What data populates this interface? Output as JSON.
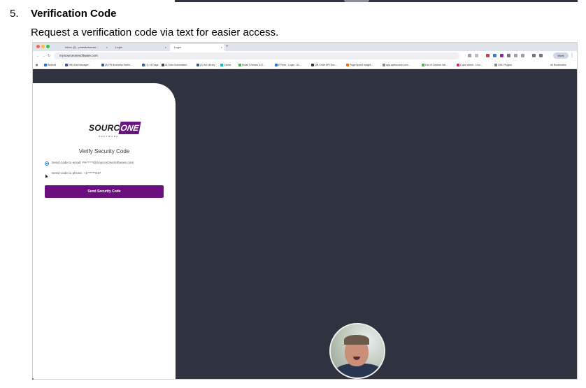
{
  "step": {
    "number": "5.",
    "title": "Verification Code",
    "description": "Request a verification code via text for easier access."
  },
  "browser": {
    "tabs": [
      {
        "label": "Inbox (2) - pmedicisoruer...",
        "active": false
      },
      {
        "label": "Login",
        "active": false
      },
      {
        "label": "Login",
        "active": true
      }
    ],
    "new_tab": "+",
    "url": "my.sourceonesoftware.com",
    "profile": "Work",
    "bookmarks": [
      {
        "label": "Besedd",
        "color": "#1a73e8"
      },
      {
        "label": "(96) Ads Manager...",
        "color": "#3b5998"
      },
      {
        "label": "(5) FB Business Settin...",
        "color": "#3b5998"
      },
      {
        "label": "(1) 14 Days",
        "color": "#3b5998"
      },
      {
        "label": "AI Lead Automation",
        "color": "#444444"
      },
      {
        "label": "(1) Ad Library",
        "color": "#3b5998"
      },
      {
        "label": "Canva",
        "color": "#00c4cc"
      },
      {
        "label": "Email Checker & E...",
        "color": "#4caf50"
      },
      {
        "label": "EPbrer - Login - Al...",
        "color": "#1a73e8"
      },
      {
        "label": "QR Code API Doc...",
        "color": "#333333"
      },
      {
        "label": "PageSpeed Insight...",
        "color": "#ff6d00"
      },
      {
        "label": "app.apbsource.com...",
        "color": "#888888"
      },
      {
        "label": "List of Custom Val...",
        "color": "#4caf50"
      },
      {
        "label": "Color wheel - Lico...",
        "color": "#e91e63"
      },
      {
        "label": "GHL Plugins",
        "color": "#888888"
      }
    ],
    "all_bookmarks": "All Bookmarks"
  },
  "login": {
    "logo_source": "SOURCE",
    "logo_one": "ONE",
    "logo_sub": "SOFTWARE",
    "heading": "Verify Security Code",
    "option_email": "Send code to email: Pe*****@SourceOneSoftware.com",
    "option_phone": "Send code to phone: +1******617",
    "selected_option": "email",
    "button_label": "Send Security Code"
  },
  "colors": {
    "brand_purple": "#6b0f7e",
    "dark_background": "#2f3340"
  }
}
